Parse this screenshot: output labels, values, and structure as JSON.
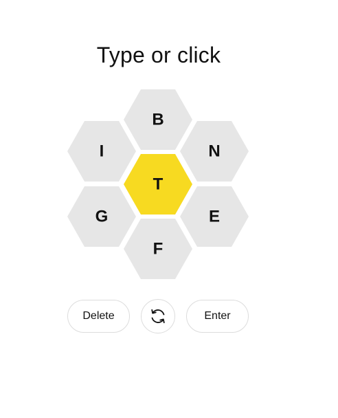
{
  "prompt": "Type or click",
  "colors": {
    "outer_cell": "#e6e6e6",
    "center_cell": "#f7da21",
    "letter": "#111111",
    "button_border": "#dcdcdc"
  },
  "letters": {
    "center": "T",
    "top": "B",
    "upper_left": "I",
    "upper_right": "N",
    "lower_left": "G",
    "lower_right": "E",
    "bottom": "F"
  },
  "controls": {
    "delete_label": "Delete",
    "shuffle_icon": "shuffle-icon",
    "enter_label": "Enter"
  }
}
